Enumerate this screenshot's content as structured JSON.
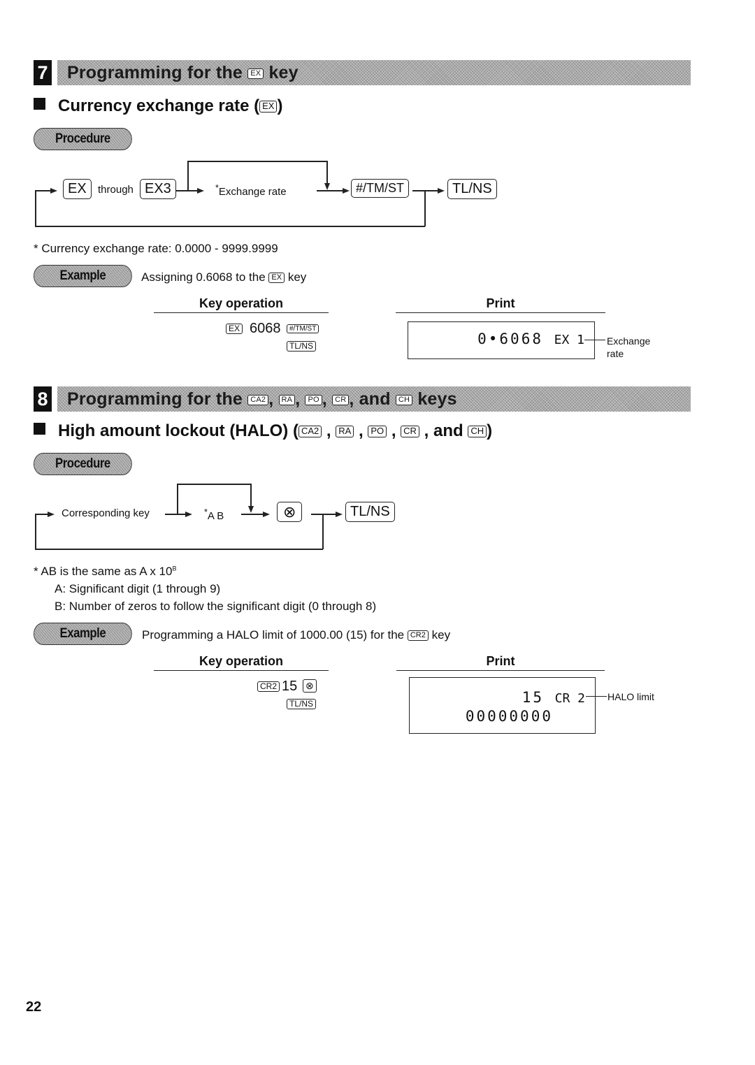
{
  "page_number": "22",
  "section7": {
    "number": "7",
    "title_prefix": "Programming for the",
    "title_key": "EX",
    "title_suffix": "key",
    "subsection": {
      "title": "Currency exchange rate (",
      "title_key": "EX",
      "title_close": ")"
    },
    "procedure_label": "Procedure",
    "diagram": {
      "key_start": "EX",
      "through": "through",
      "key_end": "EX3",
      "entry": "Exchange rate",
      "asterisk": "*",
      "key_subtotal": "#/TM/ST",
      "key_total": "TL/NS"
    },
    "footnote": "* Currency exchange rate: 0.0000 - 9999.9999",
    "example": {
      "label": "Example",
      "desc_prefix": "Assigning 0.6068 to the",
      "desc_key": "EX",
      "desc_suffix": "key",
      "key_operation_header": "Key operation",
      "print_header": "Print",
      "key_op": {
        "key1": "EX",
        "value": "6068",
        "key2": "#/TM/ST",
        "key3": "TL/NS"
      },
      "receipt": {
        "line1_value": "0•6068",
        "line1_code": "EX 1"
      },
      "annotation": "Exchange rate"
    }
  },
  "section8": {
    "number": "8",
    "title_prefix": "Programming for the",
    "title_keys": [
      "CA2",
      "RA",
      "PO",
      "CR",
      "CH"
    ],
    "title_and": "and",
    "title_suffix": "keys",
    "subsection": {
      "title": "High amount lockout (HALO) (",
      "keys": [
        "CA2",
        "RA",
        "PO",
        "CR",
        "CH"
      ],
      "and": "and",
      "title_close": ")"
    },
    "procedure_label": "Procedure",
    "diagram": {
      "entry_key": "Corresponding key",
      "asterisk": "*",
      "entry": "A B",
      "key_multiply": "⊗",
      "key_total": "TL/NS"
    },
    "footnotes": {
      "line1_prefix": "* AB is the same as A x 10",
      "line1_sup": "B",
      "line2": "A: Significant digit (1 through 9)",
      "line3": "B: Number of zeros to follow the significant digit (0 through 8)"
    },
    "example": {
      "label": "Example",
      "desc_prefix": "Programming a HALO limit of 1000.00 (15) for the",
      "desc_key": "CR2",
      "desc_suffix": "key",
      "key_operation_header": "Key operation",
      "print_header": "Print",
      "key_op": {
        "key1": "CR2",
        "value": "15",
        "key2": "⊗",
        "key3": "TL/NS"
      },
      "receipt": {
        "line1_value": "15",
        "line1_code": "CR 2",
        "line2": "00000000"
      },
      "annotation": "HALO limit"
    }
  }
}
